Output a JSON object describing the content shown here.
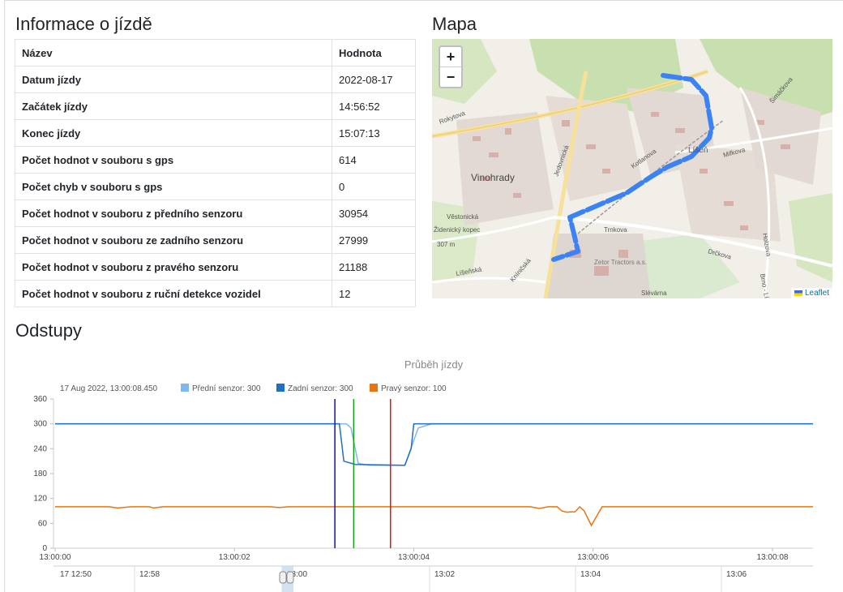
{
  "info": {
    "title": "Informace o jízdě",
    "headers": {
      "name": "Název",
      "value": "Hodnota"
    },
    "rows": [
      {
        "name": "Datum jízdy",
        "value": "2022-08-17"
      },
      {
        "name": "Začátek jízdy",
        "value": "14:56:52"
      },
      {
        "name": "Konec jízdy",
        "value": "15:07:13"
      },
      {
        "name": "Počet hodnot v souboru s gps",
        "value": "614"
      },
      {
        "name": "Počet chyb v souboru s gps",
        "value": "0"
      },
      {
        "name": "Počet hodnot v souboru z předního senzoru",
        "value": "30954"
      },
      {
        "name": "Počet hodnot v souboru ze zadního senzoru",
        "value": "27999"
      },
      {
        "name": "Počet hodnot v souboru z pravého senzoru",
        "value": "21188"
      },
      {
        "name": "Počet hodnot v souboru z ruční detekce vozidel",
        "value": "12"
      }
    ]
  },
  "map": {
    "title": "Mapa",
    "zoom_in": "+",
    "zoom_out": "−",
    "attribution": "Leaflet",
    "labels": [
      "Vinohrady",
      "Líšeň",
      "Jedovnická",
      "Rokytova",
      "Trnkova",
      "Drčkova",
      "Věstonická",
      "Židenický kopec",
      "307 m",
      "Zetor Tractors a.s.",
      "Kotlanova",
      "Mifkova",
      "Holzova",
      "Šimáčkova",
      "Líšeňská",
      "Kníničská",
      "Slévárna",
      "Brno - Líšeň"
    ],
    "route_color": "#3b82f6"
  },
  "odstupy": {
    "title": "Odstupy"
  },
  "chart_data": {
    "type": "line",
    "title": "Průběh jízdy",
    "legend_time": "17 Aug 2022, 13:00:08.450",
    "x_ticks": [
      "13:00:00",
      "13:00:02",
      "13:00:04",
      "13:00:06",
      "13:00:08"
    ],
    "ylim": [
      0,
      360
    ],
    "y_ticks": [
      0,
      60,
      120,
      180,
      240,
      300,
      360
    ],
    "x_range_seconds": [
      0,
      8
    ],
    "series": [
      {
        "name": "Přední senzor",
        "legend_value": "Přední senzor: 300",
        "color": "#7fb8f0",
        "points": [
          [
            0,
            300
          ],
          [
            3.0,
            300
          ],
          [
            3.05,
            300
          ],
          [
            3.25,
            300
          ],
          [
            3.3,
            290
          ],
          [
            3.38,
            205
          ],
          [
            3.5,
            200
          ],
          [
            3.9,
            200
          ],
          [
            4.05,
            290
          ],
          [
            4.2,
            300
          ],
          [
            8,
            300
          ]
        ]
      },
      {
        "name": "Zadní senzor",
        "legend_value": "Zadní senzor: 300",
        "color": "#1f6fc4",
        "points": [
          [
            0,
            300
          ],
          [
            3.1,
            300
          ],
          [
            3.17,
            300
          ],
          [
            3.22,
            210
          ],
          [
            3.35,
            202
          ],
          [
            3.9,
            200
          ],
          [
            3.97,
            240
          ],
          [
            4.0,
            300
          ],
          [
            8,
            300
          ]
        ]
      },
      {
        "name": "Pravý senzor",
        "legend_value": "Pravý senzor: 100",
        "color": "#e87511",
        "points": [
          [
            0,
            100
          ],
          [
            0.6,
            100
          ],
          [
            0.7,
            97
          ],
          [
            0.85,
            100
          ],
          [
            1.05,
            100
          ],
          [
            1.1,
            97
          ],
          [
            1.2,
            100
          ],
          [
            2.4,
            100
          ],
          [
            2.5,
            98
          ],
          [
            2.6,
            100
          ],
          [
            5.3,
            100
          ],
          [
            5.4,
            96
          ],
          [
            5.5,
            100
          ],
          [
            5.6,
            100
          ],
          [
            5.65,
            90
          ],
          [
            5.7,
            87
          ],
          [
            5.8,
            88
          ],
          [
            5.85,
            100
          ],
          [
            5.9,
            90
          ],
          [
            5.98,
            55
          ],
          [
            6.1,
            100
          ],
          [
            8,
            100
          ]
        ]
      }
    ],
    "markers": [
      {
        "x": 3.12,
        "color": "#1010c0"
      },
      {
        "x": 3.33,
        "color": "#13a013"
      },
      {
        "x": 3.74,
        "color": "#e01414"
      }
    ],
    "navigator": {
      "labels": [
        "17 12:50",
        "12:58",
        "13:00",
        "13:02",
        "13:04",
        "13:06"
      ]
    }
  }
}
